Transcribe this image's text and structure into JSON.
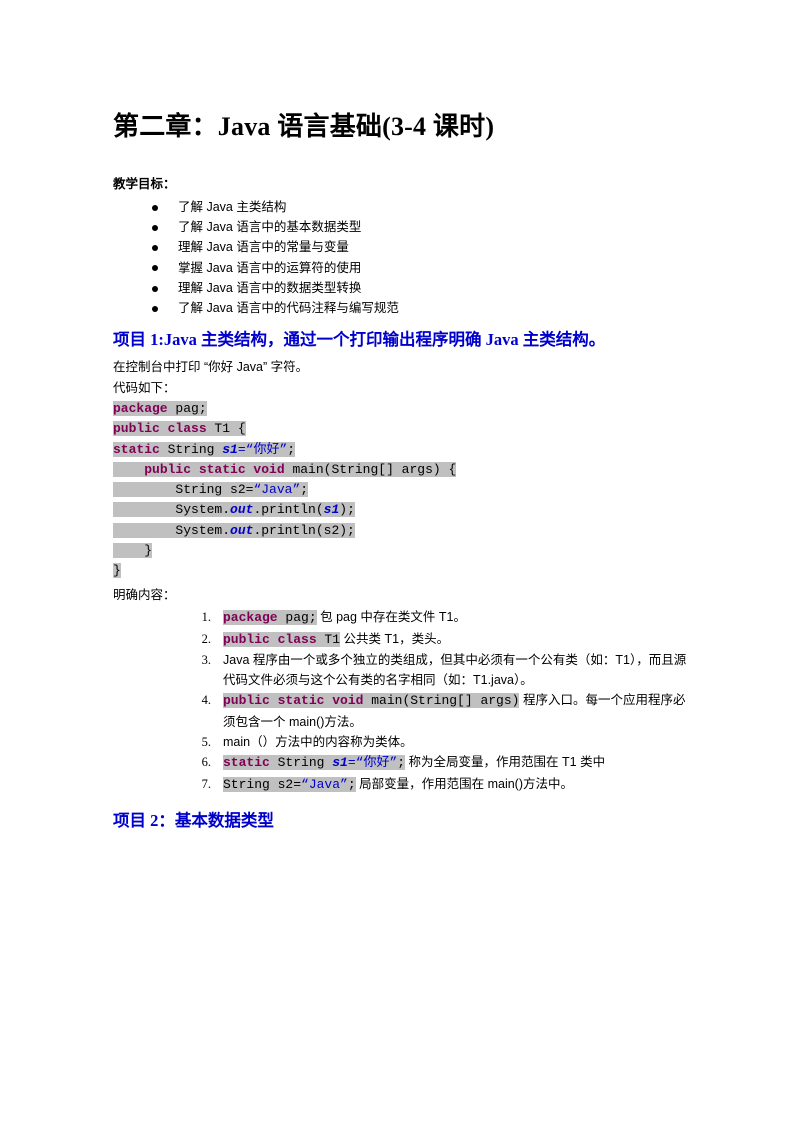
{
  "document": {
    "title": "第二章：Java 语言基础(3-4 课时)",
    "objectives_label": "教学目标：",
    "objectives": [
      "了解 Java 主类结构",
      "了解 Java 语言中的基本数据类型",
      "理解 Java 语言中的常量与变量",
      "掌握 Java 语言中的运算符的使用",
      "理解 Java 语言中的数据类型转换",
      "了解 Java 语言中的代码注释与编写规范"
    ],
    "project1_heading": "项目 1:Java 主类结构，通过一个打印输出程序明确 Java 主类结构。",
    "intro_line1": "在控制台中打印 “你好 Java” 字符。",
    "intro_line2": "代码如下：",
    "code": {
      "line1_kw": "package",
      "line1_rest": " pag;",
      "line2_kw": "public class",
      "line2_rest": " T1 {",
      "line3_kw": "static",
      "line3_mid": " String ",
      "line3_var": "s1",
      "line3_str": "=“你好”",
      "line3_end": ";",
      "line4_indent": "    ",
      "line4_kw": "public static void",
      "line4_rest": " main(String[] args) {",
      "line5_indent": "        ",
      "line5_pre": "String s2=",
      "line5_str": "“Java”",
      "line5_end": ";",
      "line6_indent": "        ",
      "line6_pre": "System.",
      "line6_fld": "out",
      "line6_mid": ".println(",
      "line6_var": "s1",
      "line6_end": ");",
      "line7_indent": "        ",
      "line7_pre": "System.",
      "line7_fld": "out",
      "line7_mid": ".println(s2);",
      "line8": "    }",
      "line9": "}"
    },
    "explain_label": "明确内容：",
    "explain_items": [
      {
        "code_kw": "package",
        "code_rest": " pag;",
        "text": " 包 pag 中存在类文件 T1。"
      },
      {
        "code_kw": "public class",
        "code_rest": " T1",
        "text": " 公共类 T1，类头。"
      },
      {
        "text": "Java 程序由一个或多个独立的类组成，但其中必须有一个公有类（如：T1），而且源代码文件必须与这个公有类的名字相同（如：T1.java）。"
      },
      {
        "code_kw": "public static void",
        "code_rest": " main(String[] args)",
        "text": " 程序入口。每一个应用程序必须包含一个 main()方法。"
      },
      {
        "text": "main（）方法中的内容称为类体。"
      },
      {
        "code_kw": "static",
        "code_mid": " String ",
        "code_var": "s1",
        "code_str": "=“你好”",
        "code_end": ";",
        "text": " 称为全局变量，作用范围在 T1 类中"
      },
      {
        "code_pre": "String s2=",
        "code_str": "“Java”",
        "code_end": ";",
        "text": " 局部变量，作用范围在 main()方法中。"
      }
    ],
    "project2_heading": "项目 2：基本数据类型"
  },
  "colors": {
    "keyword": "#7F0055",
    "string": "#0000CC",
    "heading_blue": "#0000CC",
    "highlight_gray": "#C0C0C0",
    "text": "#000000"
  }
}
